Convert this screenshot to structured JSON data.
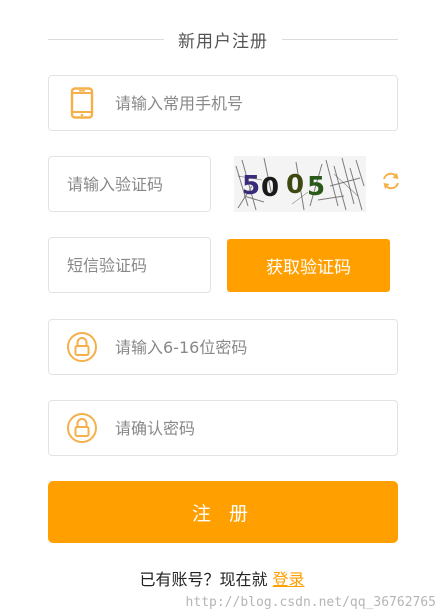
{
  "header": {
    "title": "新用户注册"
  },
  "form": {
    "phone_placeholder": "请输入常用手机号",
    "captcha_placeholder": "请输入验证码",
    "captcha_text": "5005",
    "sms_placeholder": "短信验证码",
    "sms_button": "获取验证码",
    "password_placeholder": "请输入6-16位密码",
    "confirm_placeholder": "请确认密码",
    "register_button": "注 册"
  },
  "footer": {
    "prompt": "已有账号？现在就",
    "login_link": "登录"
  },
  "watermark": "http://blog.csdn.net/qq_36762765",
  "colors": {
    "accent": "#ff9f00",
    "icon": "#f5b04a",
    "border": "#e3e3e3"
  },
  "icons": [
    "phone-icon",
    "refresh-icon",
    "lock-icon"
  ]
}
